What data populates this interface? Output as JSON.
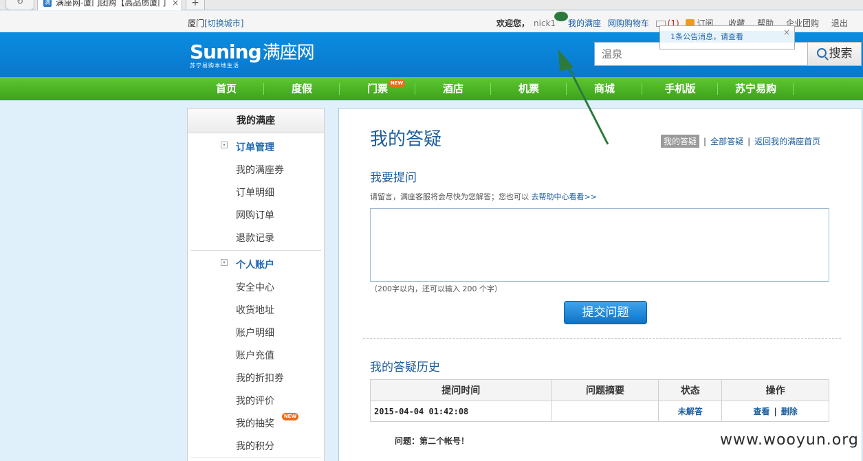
{
  "browser": {
    "tab_title": "满座网-厦门团购【高品质厦门",
    "tab_close": "×",
    "new_tab": "+"
  },
  "topbar": {
    "city": "厦门",
    "switch_city": "[切换城市]",
    "welcome": "欢迎您，",
    "nickname": "nick1",
    "links": [
      "我的满座",
      "网购购物车"
    ],
    "mail_count": "(1)",
    "subscribe": "订阅",
    "favorites": "收藏",
    "help": "帮助",
    "enterprise": "企业团购",
    "logout": "退出"
  },
  "notice": {
    "text": "1条公告消息，请查看",
    "close": "×"
  },
  "header": {
    "logo_brand": "Suning",
    "logo_site": "满座网",
    "logo_tagline": "苏宁易购本地生活",
    "search_placeholder": "温泉",
    "search_button": "搜索"
  },
  "nav": {
    "items": [
      "首页",
      "度假",
      "门票",
      "酒店",
      "机票",
      "商城",
      "手机版",
      "苏宁易购"
    ],
    "new_badge": "NEW"
  },
  "sidebar": {
    "title": "我的满座",
    "groups": [
      {
        "title": "订单管理",
        "toggle": "▾",
        "items": [
          "我的满座券",
          "订单明细",
          "网购订单",
          "退款记录"
        ]
      },
      {
        "title": "个人账户",
        "toggle": "▾",
        "items": [
          "安全中心",
          "收货地址",
          "账户明细",
          "账户充值",
          "我的折扣券",
          "我的评价",
          "我的抽奖",
          "我的积分"
        ]
      }
    ],
    "new_badge": "NEW"
  },
  "main": {
    "title": "我的答疑",
    "tools": {
      "current": "我的答疑",
      "all": "全部答疑",
      "back": "返回我的满座首页",
      "sep": "|"
    },
    "ask_title": "我要提问",
    "hint_text": "请留言，满座客服将会尽快为您解答；您也可以",
    "hint_link": "去帮助中心看看>>",
    "question_value": "",
    "counter": "（200字以内，还可以输入 200 个字）",
    "submit": "提交问题",
    "history_title": "我的答疑历史",
    "table": {
      "headers": [
        "提问时间",
        "问题摘要",
        "状态",
        "操作"
      ],
      "rows": [
        {
          "time": "2015-04-04 01:42:08",
          "summary": "",
          "status": "未解答",
          "view": "查看",
          "delete": "删除"
        }
      ]
    },
    "question_label": "问题：第二个帐号！"
  },
  "watermark": "www.wooyun.org",
  "colors": {
    "header_blue": "#0a86da",
    "nav_green": "#4cb525",
    "link_blue": "#1d5e9c",
    "arrow_green": "#2c7a3b"
  }
}
